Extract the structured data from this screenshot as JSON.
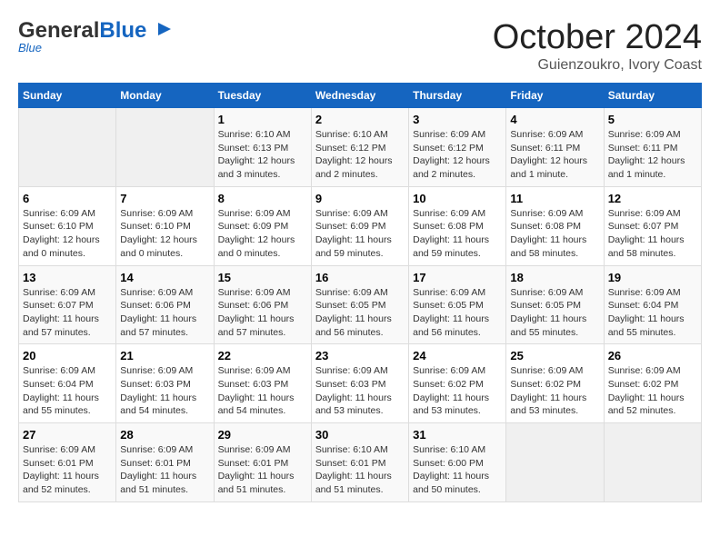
{
  "header": {
    "logo_general": "General",
    "logo_blue": "Blue",
    "month": "October 2024",
    "location": "Guienzoukro, Ivory Coast"
  },
  "days_of_week": [
    "Sunday",
    "Monday",
    "Tuesday",
    "Wednesday",
    "Thursday",
    "Friday",
    "Saturday"
  ],
  "weeks": [
    [
      {
        "day": "",
        "info": ""
      },
      {
        "day": "",
        "info": ""
      },
      {
        "day": "1",
        "info": "Sunrise: 6:10 AM\nSunset: 6:13 PM\nDaylight: 12 hours and 3 minutes."
      },
      {
        "day": "2",
        "info": "Sunrise: 6:10 AM\nSunset: 6:12 PM\nDaylight: 12 hours and 2 minutes."
      },
      {
        "day": "3",
        "info": "Sunrise: 6:09 AM\nSunset: 6:12 PM\nDaylight: 12 hours and 2 minutes."
      },
      {
        "day": "4",
        "info": "Sunrise: 6:09 AM\nSunset: 6:11 PM\nDaylight: 12 hours and 1 minute."
      },
      {
        "day": "5",
        "info": "Sunrise: 6:09 AM\nSunset: 6:11 PM\nDaylight: 12 hours and 1 minute."
      }
    ],
    [
      {
        "day": "6",
        "info": "Sunrise: 6:09 AM\nSunset: 6:10 PM\nDaylight: 12 hours and 0 minutes."
      },
      {
        "day": "7",
        "info": "Sunrise: 6:09 AM\nSunset: 6:10 PM\nDaylight: 12 hours and 0 minutes."
      },
      {
        "day": "8",
        "info": "Sunrise: 6:09 AM\nSunset: 6:09 PM\nDaylight: 12 hours and 0 minutes."
      },
      {
        "day": "9",
        "info": "Sunrise: 6:09 AM\nSunset: 6:09 PM\nDaylight: 11 hours and 59 minutes."
      },
      {
        "day": "10",
        "info": "Sunrise: 6:09 AM\nSunset: 6:08 PM\nDaylight: 11 hours and 59 minutes."
      },
      {
        "day": "11",
        "info": "Sunrise: 6:09 AM\nSunset: 6:08 PM\nDaylight: 11 hours and 58 minutes."
      },
      {
        "day": "12",
        "info": "Sunrise: 6:09 AM\nSunset: 6:07 PM\nDaylight: 11 hours and 58 minutes."
      }
    ],
    [
      {
        "day": "13",
        "info": "Sunrise: 6:09 AM\nSunset: 6:07 PM\nDaylight: 11 hours and 57 minutes."
      },
      {
        "day": "14",
        "info": "Sunrise: 6:09 AM\nSunset: 6:06 PM\nDaylight: 11 hours and 57 minutes."
      },
      {
        "day": "15",
        "info": "Sunrise: 6:09 AM\nSunset: 6:06 PM\nDaylight: 11 hours and 57 minutes."
      },
      {
        "day": "16",
        "info": "Sunrise: 6:09 AM\nSunset: 6:05 PM\nDaylight: 11 hours and 56 minutes."
      },
      {
        "day": "17",
        "info": "Sunrise: 6:09 AM\nSunset: 6:05 PM\nDaylight: 11 hours and 56 minutes."
      },
      {
        "day": "18",
        "info": "Sunrise: 6:09 AM\nSunset: 6:05 PM\nDaylight: 11 hours and 55 minutes."
      },
      {
        "day": "19",
        "info": "Sunrise: 6:09 AM\nSunset: 6:04 PM\nDaylight: 11 hours and 55 minutes."
      }
    ],
    [
      {
        "day": "20",
        "info": "Sunrise: 6:09 AM\nSunset: 6:04 PM\nDaylight: 11 hours and 55 minutes."
      },
      {
        "day": "21",
        "info": "Sunrise: 6:09 AM\nSunset: 6:03 PM\nDaylight: 11 hours and 54 minutes."
      },
      {
        "day": "22",
        "info": "Sunrise: 6:09 AM\nSunset: 6:03 PM\nDaylight: 11 hours and 54 minutes."
      },
      {
        "day": "23",
        "info": "Sunrise: 6:09 AM\nSunset: 6:03 PM\nDaylight: 11 hours and 53 minutes."
      },
      {
        "day": "24",
        "info": "Sunrise: 6:09 AM\nSunset: 6:02 PM\nDaylight: 11 hours and 53 minutes."
      },
      {
        "day": "25",
        "info": "Sunrise: 6:09 AM\nSunset: 6:02 PM\nDaylight: 11 hours and 53 minutes."
      },
      {
        "day": "26",
        "info": "Sunrise: 6:09 AM\nSunset: 6:02 PM\nDaylight: 11 hours and 52 minutes."
      }
    ],
    [
      {
        "day": "27",
        "info": "Sunrise: 6:09 AM\nSunset: 6:01 PM\nDaylight: 11 hours and 52 minutes."
      },
      {
        "day": "28",
        "info": "Sunrise: 6:09 AM\nSunset: 6:01 PM\nDaylight: 11 hours and 51 minutes."
      },
      {
        "day": "29",
        "info": "Sunrise: 6:09 AM\nSunset: 6:01 PM\nDaylight: 11 hours and 51 minutes."
      },
      {
        "day": "30",
        "info": "Sunrise: 6:10 AM\nSunset: 6:01 PM\nDaylight: 11 hours and 51 minutes."
      },
      {
        "day": "31",
        "info": "Sunrise: 6:10 AM\nSunset: 6:00 PM\nDaylight: 11 hours and 50 minutes."
      },
      {
        "day": "",
        "info": ""
      },
      {
        "day": "",
        "info": ""
      }
    ]
  ]
}
